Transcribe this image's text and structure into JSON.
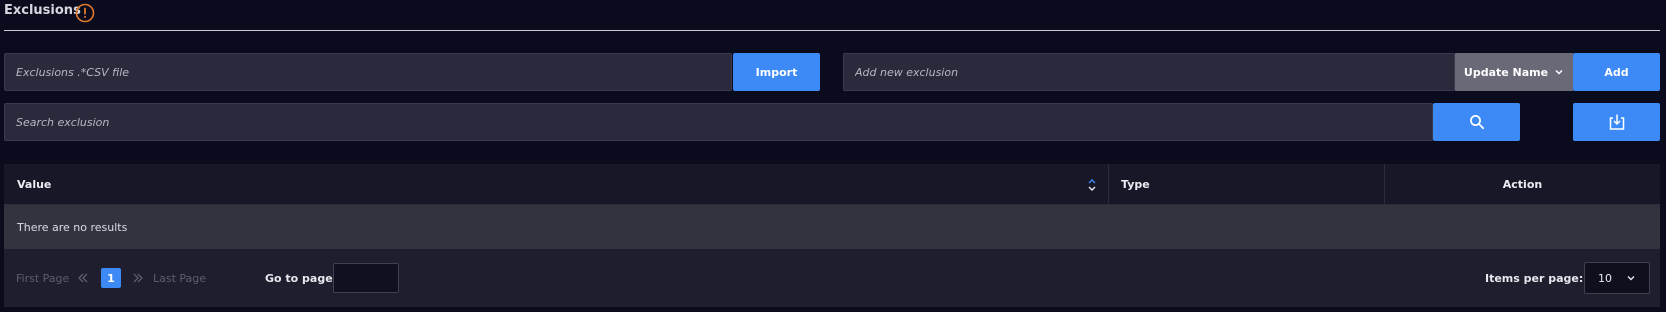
{
  "header": {
    "title": "Exclusions",
    "warning_icon": "exclamation-circle-icon",
    "warning_color": "#e0782b"
  },
  "import_row": {
    "file_placeholder": "Exclusions .*CSV file",
    "import_label": "Import"
  },
  "add_row": {
    "placeholder": "Add new exclusion",
    "type_select_value": "Update Name",
    "add_label": "Add"
  },
  "search_row": {
    "placeholder": "Search exclusion",
    "search_icon": "search-icon",
    "download_icon": "download-icon"
  },
  "table": {
    "columns": [
      "Value",
      "Type",
      "Action"
    ],
    "sort_icon": "sort-icon",
    "empty_message": "There are no results"
  },
  "pagination": {
    "first_label": "First Page",
    "last_label": "Last Page",
    "current_page": "1",
    "goto_label": "Go to page:",
    "items_per_page_label": "Items per page:",
    "items_per_page_value": "10"
  },
  "colors": {
    "accent": "#3d8af7",
    "background": "#0b0b1e"
  }
}
